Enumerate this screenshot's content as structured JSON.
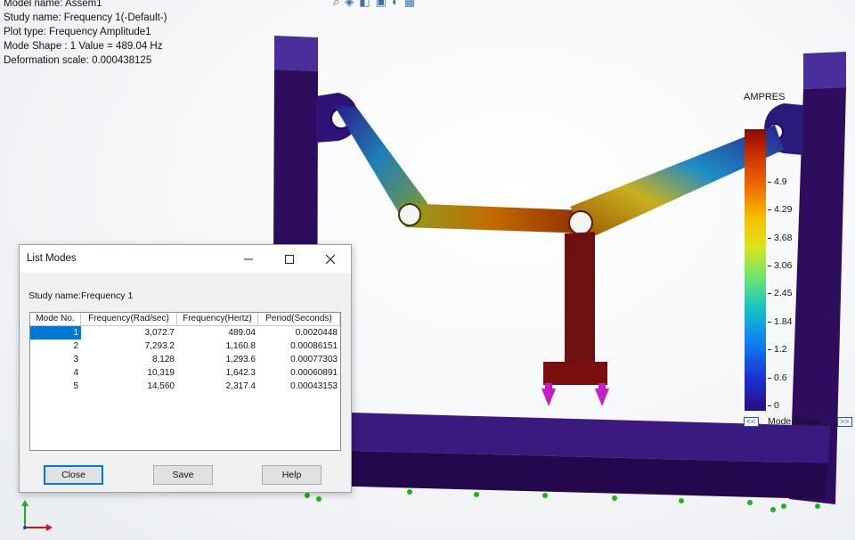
{
  "info": {
    "model": "Model name: Assem1",
    "study": "Study name: Frequency 1(-Default-)",
    "plot": "Plot type: Frequency Amplitude1",
    "mode": "Mode Shape : 1  Value =       489.04 Hz",
    "deform": "Deformation scale: 0.000438125"
  },
  "legend": {
    "title": "AMPRES",
    "ticks": [
      "4.9",
      "4.29",
      "3.68",
      "3.06",
      "2.45",
      "1.84",
      "1.2",
      "0.6",
      "0"
    ],
    "nav_prev": "<<",
    "nav_next": ">>",
    "nav_label": "Mode Shape"
  },
  "dialog": {
    "title": "List Modes",
    "study_label": "Study name:Frequency 1",
    "columns": [
      "Mode No.",
      "Frequency(Rad/sec)",
      "Frequency(Hertz)",
      "Period(Seconds)"
    ],
    "rows": [
      [
        "1",
        "3,072.7",
        "489.04",
        "0.0020448"
      ],
      [
        "2",
        "7,293.2",
        "1,160.8",
        "0.00086151"
      ],
      [
        "3",
        "8,128",
        "1,293.6",
        "0.00077303"
      ],
      [
        "4",
        "10,319",
        "1,642.3",
        "0.00060891"
      ],
      [
        "5",
        "14,560",
        "2,317.4",
        "0.00043153"
      ]
    ],
    "close_label": "Close",
    "save_label": "Save",
    "help_label": "Help"
  },
  "colors": {
    "frame": "#2e0c5e",
    "selection": "#0078d7",
    "fixture": "#1db31d",
    "load": "#c21fc4"
  },
  "icons": [
    "minimize-icon",
    "maximize-icon",
    "close-icon",
    "axis-triad-icon"
  ]
}
